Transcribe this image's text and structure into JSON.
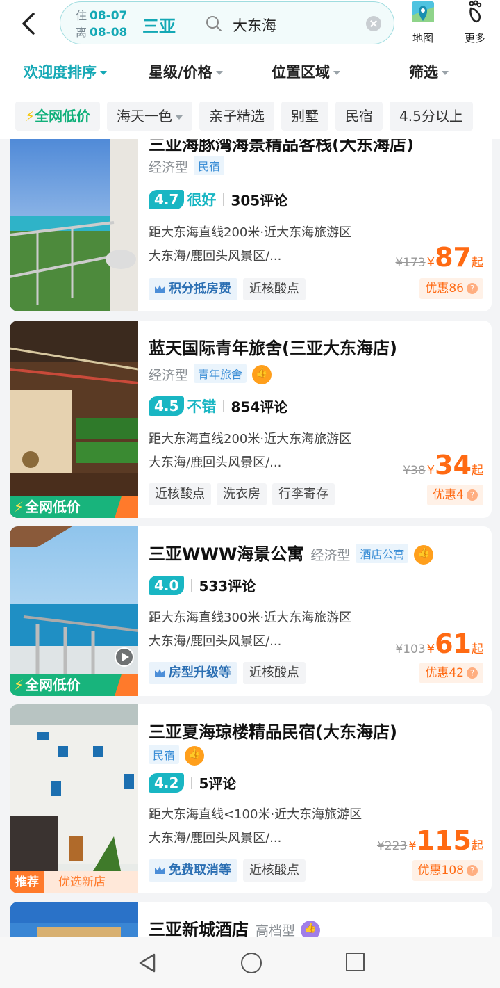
{
  "header": {
    "checkin_label": "住",
    "checkin_date": "08-07",
    "checkout_label": "离",
    "checkout_date": "08-08",
    "city": "三亚",
    "search_query": "大东海",
    "map_label": "地图",
    "more_label": "更多"
  },
  "sort_bar": {
    "popularity": "欢迎度排序",
    "star_price": "星级/价格",
    "location": "位置区域",
    "filter": "筛选"
  },
  "chips": [
    "全网低价",
    "海天一色",
    "亲子精选",
    "别墅",
    "民宿",
    "4.5分以上"
  ],
  "hotels": [
    {
      "name": "三亚海豚湾海景精品客栈(大东海店)",
      "type": "经济型",
      "category": "民宿",
      "score": "4.7",
      "rating_label": "很好",
      "reviews": "305评论",
      "distance": "距大东海直线200米·近大东海旅游区",
      "area": "大东海/鹿回头风景区/...",
      "tags": [
        "积分抵房费",
        "近核酸点"
      ],
      "old_price": "¥173",
      "currency": "¥",
      "price": "87",
      "price_suffix": "起",
      "discount": "优惠86"
    },
    {
      "name": "蓝天国际青年旅舍(三亚大东海店)",
      "type": "经济型",
      "category": "青年旅舍",
      "score": "4.5",
      "rating_label": "不错",
      "reviews": "854评论",
      "distance": "距大东海直线200米·近大东海旅游区",
      "area": "大东海/鹿回头风景区/...",
      "tags": [
        "近核酸点",
        "洗衣房",
        "行李寄存"
      ],
      "old_price": "¥38",
      "currency": "¥",
      "price": "34",
      "price_suffix": "起",
      "discount": "优惠4",
      "badge": "全网低价"
    },
    {
      "name": "三亚WWW海景公寓",
      "type": "经济型",
      "category": "酒店公寓",
      "score": "4.0",
      "reviews": "533评论",
      "distance": "距大东海直线300米·近大东海旅游区",
      "area": "大东海/鹿回头风景区/...",
      "tags": [
        "房型升级等",
        "近核酸点"
      ],
      "old_price": "¥103",
      "currency": "¥",
      "price": "61",
      "price_suffix": "起",
      "discount": "优惠42",
      "badge": "全网低价"
    },
    {
      "name": "三亚夏海琼楼精品民宿(大东海店)",
      "category": "民宿",
      "score": "4.2",
      "reviews": "5评论",
      "distance": "距大东海直线<100米·近大东海旅游区",
      "area": "大东海/鹿回头风景区/...",
      "tags": [
        "免费取消等",
        "近核酸点"
      ],
      "old_price": "¥223",
      "currency": "¥",
      "price": "115",
      "price_suffix": "起",
      "discount": "优惠108",
      "badge_primary": "推荐",
      "badge_secondary": "优选新店"
    },
    {
      "name": "三亚新城酒店",
      "type": "高档型"
    }
  ],
  "colors": {
    "accent": "#19b6c3",
    "price": "#ff6a13",
    "low_price_green": "#18b47c"
  }
}
